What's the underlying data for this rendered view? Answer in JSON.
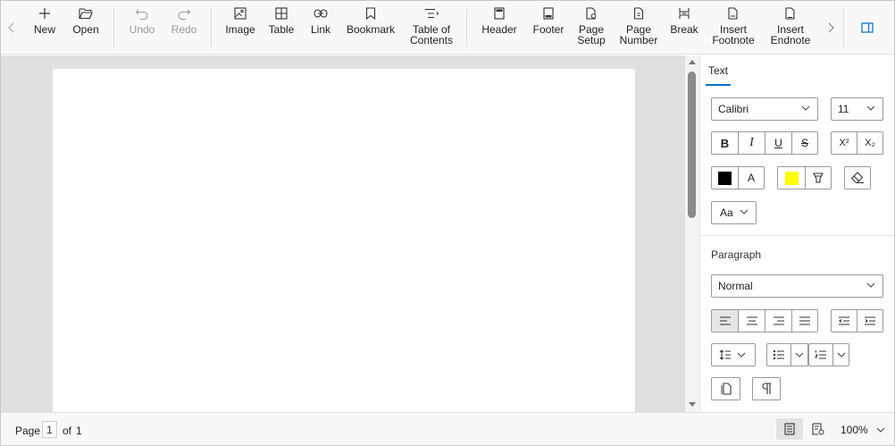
{
  "toolbar": {
    "new": "New",
    "open": "Open",
    "undo": "Undo",
    "redo": "Redo",
    "image": "Image",
    "table": "Table",
    "link": "Link",
    "bookmark": "Bookmark",
    "toc_1": "Table of",
    "toc_2": "Contents",
    "header": "Header",
    "footer": "Footer",
    "page_setup_1": "Page",
    "page_setup_2": "Setup",
    "page_number_1": "Page",
    "page_number_2": "Number",
    "break": "Break",
    "footnote_1": "Insert",
    "footnote_2": "Footnote",
    "endnote_1": "Insert",
    "endnote_2": "Endnote"
  },
  "panel": {
    "tab_text": "Text",
    "font_family": "Calibri",
    "font_size": "11",
    "bold": "B",
    "italic": "I",
    "underline": "U",
    "strike": "S",
    "superscript": "X²",
    "subscript": "X₂",
    "font_color_label": "A",
    "change_case": "Aa",
    "paragraph_title": "Paragraph",
    "style": "Normal",
    "font_color": "#000000",
    "highlight_color": "#ffff00"
  },
  "status": {
    "page_label": "Page",
    "current_page": "1",
    "of_label": "of",
    "total_pages": "1",
    "zoom": "100%"
  },
  "colors": {
    "accent": "#0a6ec4"
  }
}
